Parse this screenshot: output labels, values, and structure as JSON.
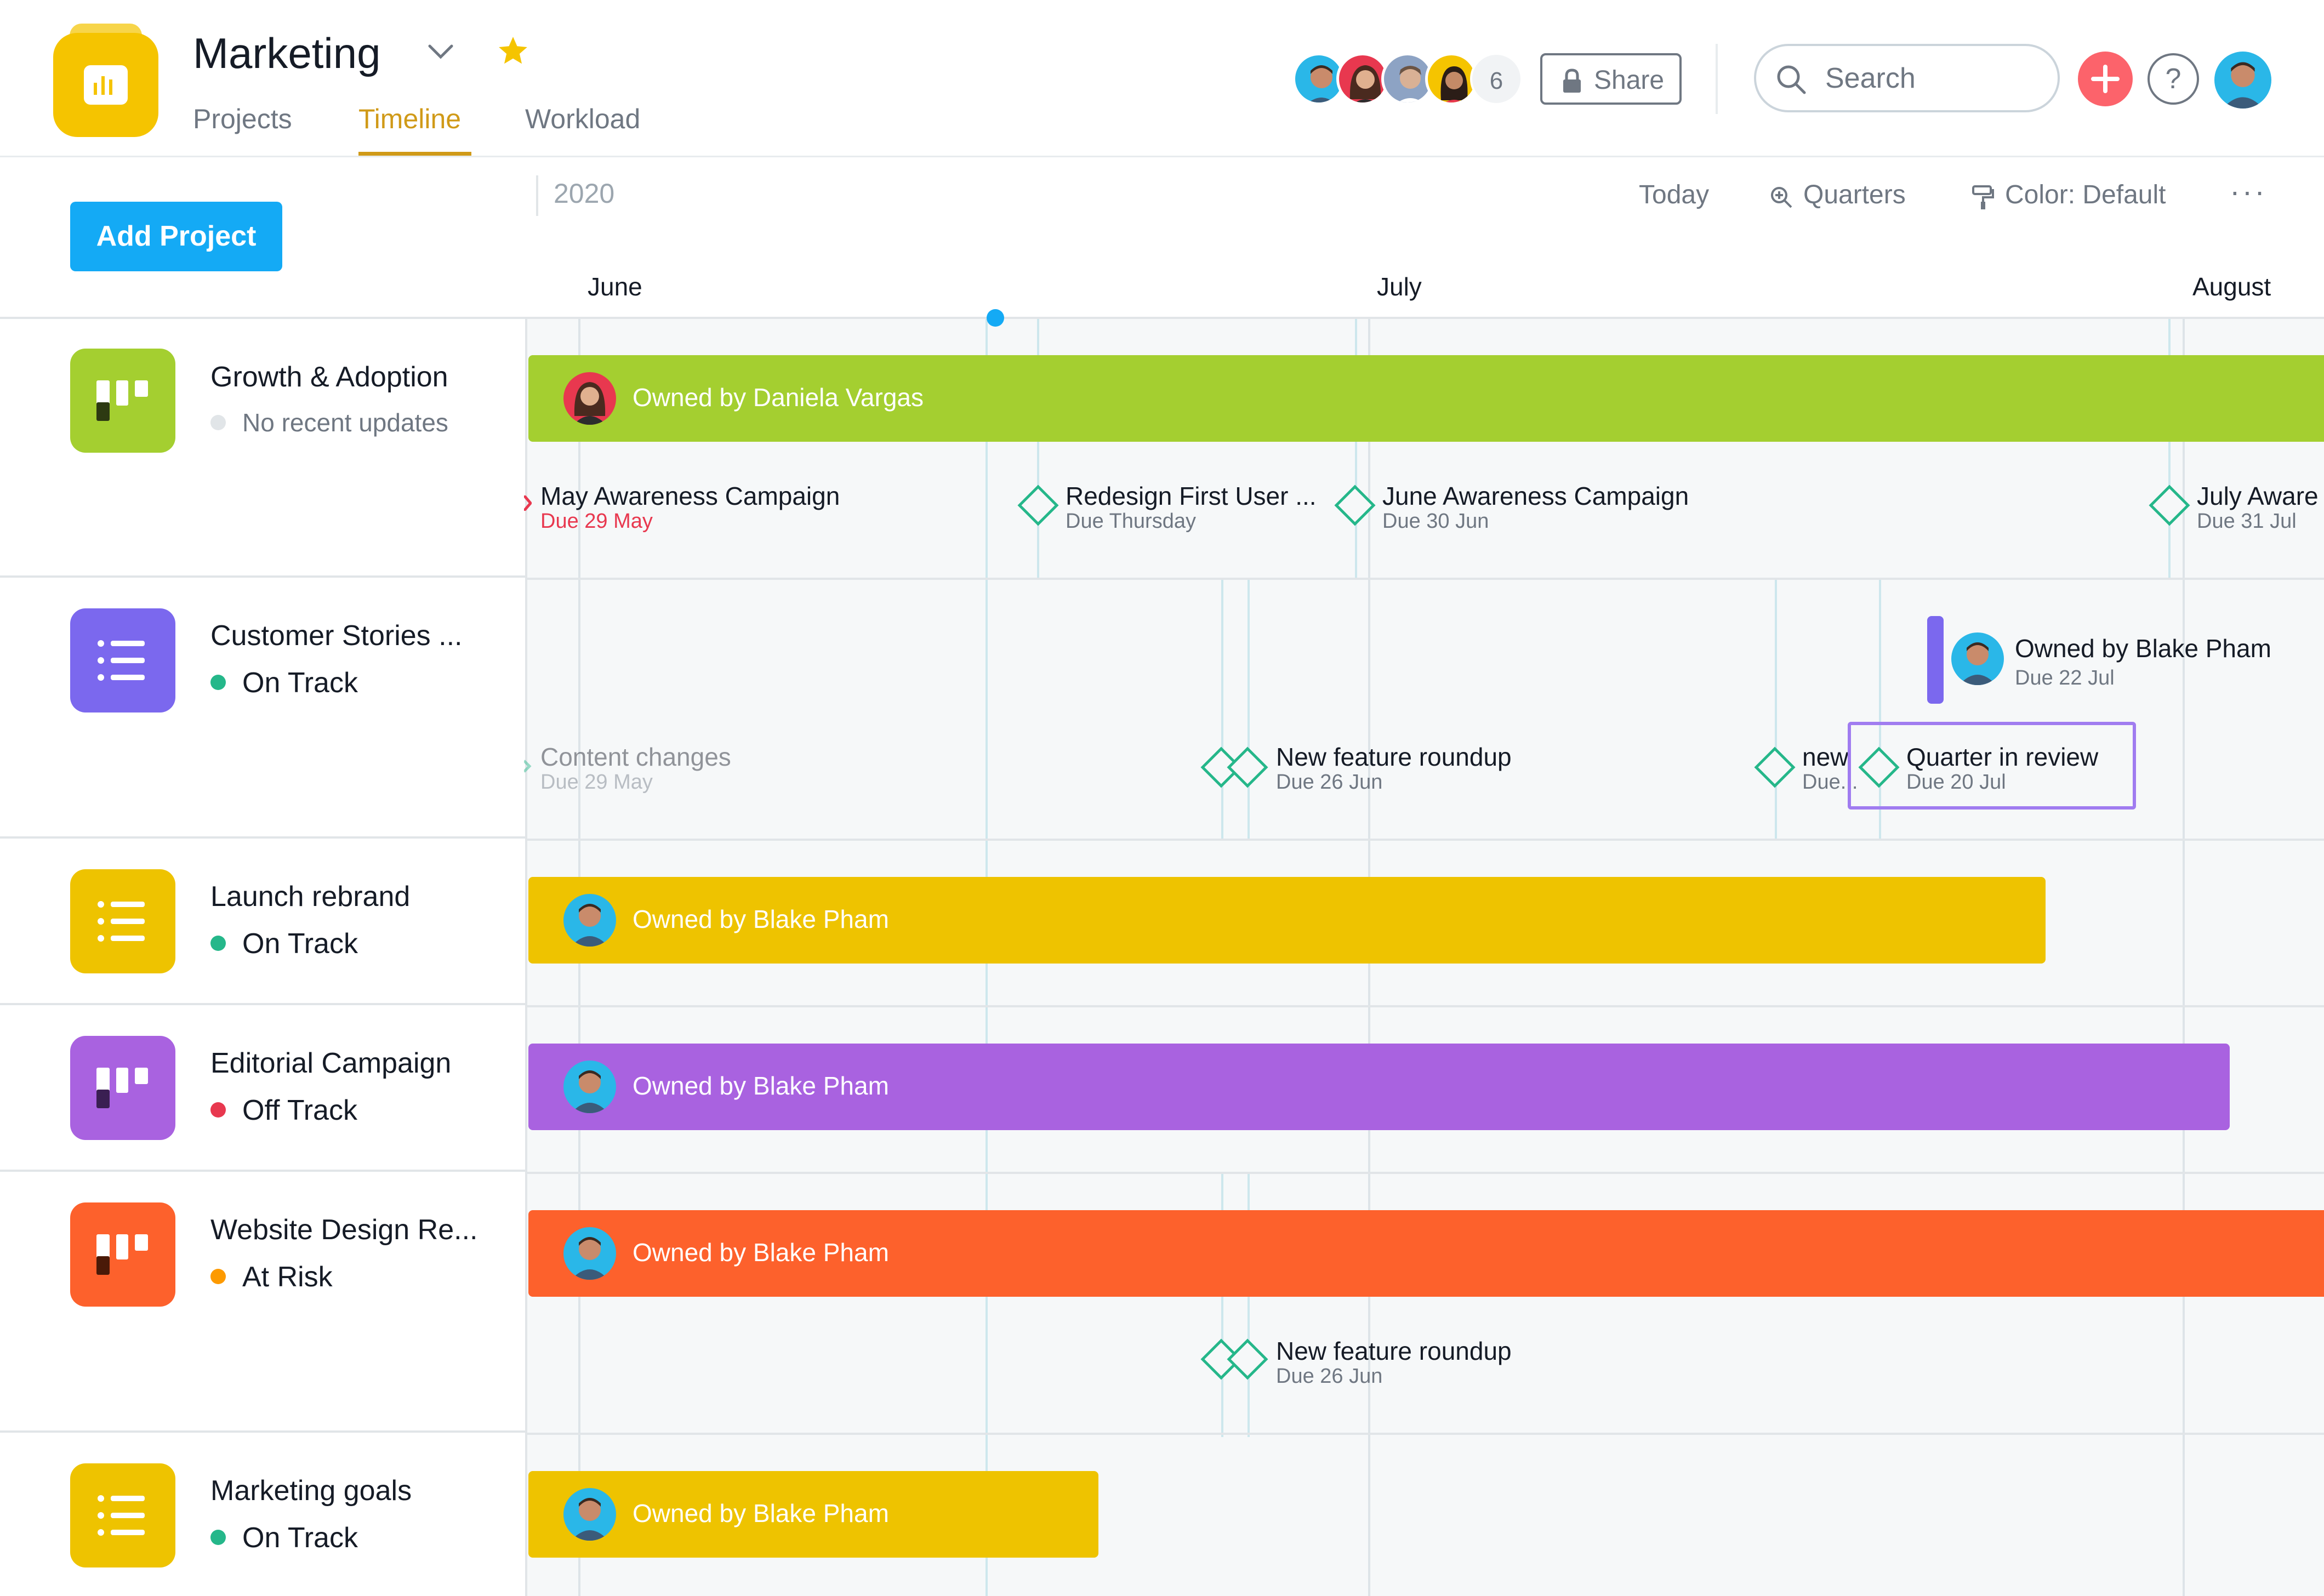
{
  "header": {
    "project_title": "Marketing",
    "tabs": [
      {
        "label": "Projects",
        "active": false
      },
      {
        "label": "Timeline",
        "active": true
      },
      {
        "label": "Workload",
        "active": false
      }
    ],
    "member_count": "6",
    "share_label": "Share",
    "search_placeholder": "Search",
    "help_label": "?"
  },
  "toolbar": {
    "add_project_label": "Add Project",
    "year": "2020",
    "today_label": "Today",
    "quarters_label": "Quarters",
    "color_label": "Color: Default",
    "more_label": "···"
  },
  "timeline": {
    "months": [
      "June",
      "July",
      "August"
    ]
  },
  "projects": [
    {
      "name": "Growth & Adoption",
      "status": "No recent updates",
      "status_color": "#e1e5e8",
      "icon_color": "#a4cf30",
      "icon": "board-icon",
      "bar": {
        "label": "Owned by Daniela Vargas",
        "color": "#a4cf30"
      },
      "milestones": [
        {
          "name": "May Awareness Campaign",
          "due": "Due 29 May",
          "overdue": true
        },
        {
          "name": "Redesign First User ...",
          "due": "Due Thursday"
        },
        {
          "name": "June Awareness Campaign",
          "due": "Due 30 Jun"
        },
        {
          "name": "July Aware",
          "due": "Due 31 Jul"
        }
      ]
    },
    {
      "name": "Customer Stories ...",
      "status": "On Track",
      "status_color": "#25b78a",
      "icon_color": "#7b68ee",
      "icon": "list-icon",
      "owner_tag": {
        "label": "Owned by Blake Pham",
        "due": "Due 22 Jul"
      },
      "milestones": [
        {
          "name": "Content changes",
          "due": "Due 29 May",
          "faded": true
        },
        {
          "name": "New feature roundup",
          "due": "Due 26 Jun"
        },
        {
          "name": "new",
          "due": "Due..."
        },
        {
          "name": "Quarter in review",
          "due": "Due 20 Jul",
          "selected": true
        }
      ]
    },
    {
      "name": "Launch rebrand",
      "status": "On Track",
      "status_color": "#25b78a",
      "icon_color": "#eec300",
      "icon": "list-icon",
      "bar": {
        "label": "Owned by Blake Pham",
        "color": "#eec300"
      }
    },
    {
      "name": "Editorial Campaign",
      "status": "Off Track",
      "status_color": "#e8384f",
      "icon_color": "#a962e0",
      "icon": "board-icon",
      "bar": {
        "label": "Owned by Blake Pham",
        "color": "#a962e0"
      }
    },
    {
      "name": "Website Design Re...",
      "status": "At Risk",
      "status_color": "#fd9a00",
      "icon_color": "#fd612c",
      "icon": "board-icon",
      "bar": {
        "label": "Owned by Blake Pham",
        "color": "#fd612c"
      },
      "milestones": [
        {
          "name": "New feature roundup",
          "due": "Due 26 Jun"
        }
      ]
    },
    {
      "name": "Marketing goals",
      "status": "On Track",
      "status_color": "#25b78a",
      "icon_color": "#eec300",
      "icon": "list-icon",
      "bar": {
        "label": "Owned by Blake Pham",
        "color": "#eec300"
      }
    }
  ],
  "colors": {
    "accent_blue": "#14aaf5",
    "timeline_tab": "#d09a18",
    "milestone": "#25b78a",
    "selection": "#a07cf0"
  }
}
